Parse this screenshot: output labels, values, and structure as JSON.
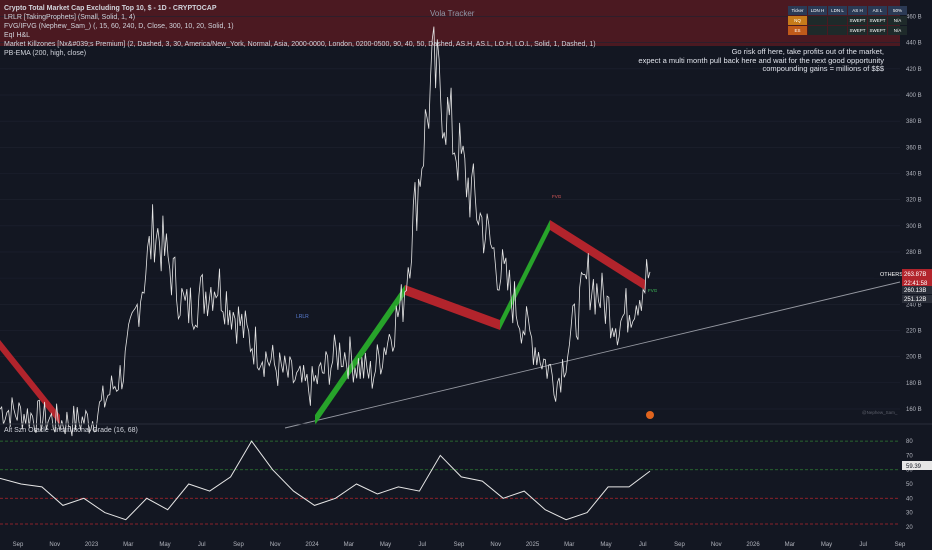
{
  "header": {
    "title": "Crypto Total Market Cap Excluding Top 10, $ - 1D - CRYPTOCAP",
    "indicators": [
      "LRLR [TakingProphets] (Small, Solid, 1, 4)",
      "FVG/IFVG (Nephew_Sam_) (, 15, 60, 240, D, Close, 300, 10, 20, Solid, 1)",
      "EqI H&L",
      "Market Killzones [Nx&#039;s Premium] (2, Dashed, 3, 30, America/New_York, Normal, Asia, 2000-0000, London, 0200-0500, 90, 40, 50, Dashed, AS.H, AS.L, LO.H, LO.L, Solid, 1, Dashed, 1)",
      "PB-EMA (200, high, close)"
    ],
    "zone_label": "Vola Tracker"
  },
  "annotation": {
    "lines": [
      "Go risk off here, take profits out of the market,",
      "expect a multi month pull back here and wait for the next good opportunity",
      "compounding gains = millions of $$$"
    ]
  },
  "table": {
    "headers": [
      "Ticker",
      "LDN H",
      "LDN L",
      "AS H",
      "AS L",
      "50%"
    ],
    "rows": [
      [
        "NQ",
        "",
        "",
        "SWEPT",
        "SWEPT",
        "N/A"
      ],
      [
        "ES",
        "",
        "",
        "SWEPT",
        "SWEPT",
        "N/A"
      ]
    ]
  },
  "badges": {
    "symbol": "OTHERS",
    "price": "263.87B",
    "countdown": "22:41:58",
    "level1": "260.13B",
    "level2": "251.12B",
    "watermark": "@Nephew_Sam_"
  },
  "markers": {
    "lrlr": "LRLR",
    "fvg": "FVG"
  },
  "colors": {
    "up_band": "#27a32a",
    "down_band": "#b2242c",
    "price": "#e6e6e6",
    "osc": "#e6e6e6",
    "bg": "#131722"
  },
  "chart_data": [
    {
      "type": "line",
      "title": "Crypto Total Market Cap Excluding Top 10, $ - 1D - CRYPTOCAP",
      "series": [
        {
          "name": "OTHERS",
          "x": [
            "2023-09",
            "2023-10",
            "2023-11",
            "2024-01",
            "2024-02",
            "2024-03",
            "2024-04",
            "2024-05",
            "2024-06",
            "2024-07",
            "2024-08",
            "2024-09",
            "2024-10",
            "2024-11",
            "2024-12",
            "2025-01",
            "2025-02",
            "2025-03",
            "2025-04",
            "2025-05",
            "2025-06",
            "2025-07"
          ],
          "values": [
            160,
            155,
            150,
            152,
            190,
            300,
            235,
            258,
            215,
            190,
            175,
            205,
            185,
            240,
            420,
            340,
            275,
            220,
            180,
            260,
            225,
            264
          ]
        }
      ],
      "ylim": [
        150,
        465
      ],
      "yticks": [
        160,
        180,
        200,
        220,
        240,
        260,
        280,
        300,
        320,
        340,
        360,
        380,
        400,
        420,
        440,
        460
      ],
      "ytick_labels": [
        "160 B",
        "180 B",
        "200 B",
        "220 B",
        "240 B",
        "260 B",
        "280 B",
        "300 B",
        "320 B",
        "340 B",
        "360 B",
        "380 B",
        "400 B",
        "420 B",
        "440 B",
        "460 B"
      ],
      "xtick_labels": [
        "Sep",
        "Nov",
        "2023",
        "Mar",
        "May",
        "Jul",
        "Sep",
        "Nov",
        "2024",
        "Mar",
        "May",
        "Jul",
        "Sep",
        "Nov",
        "2025",
        "Mar",
        "May",
        "Jul",
        "Sep",
        "Nov",
        "2026",
        "Mar",
        "May",
        "Jul",
        "Sep"
      ],
      "last_value": 263.87
    },
    {
      "type": "line",
      "title": "Alt Szn Oracle - Institutional Grade (16, 68)",
      "series": [
        {
          "values": [
            54,
            50,
            48,
            35,
            40,
            30,
            25,
            40,
            32,
            50,
            45,
            55,
            80,
            60,
            45,
            35,
            40,
            50,
            43,
            48,
            45,
            70,
            55,
            52,
            40,
            45,
            32,
            25,
            30,
            48,
            48,
            59
          ]
        }
      ],
      "ylim": [
        15,
        85
      ],
      "yticks": [
        20,
        30,
        40,
        50,
        60,
        70,
        80
      ],
      "ytick_labels": [
        "20",
        "30",
        "40",
        "50",
        "60",
        "70",
        "80"
      ],
      "levels": [
        80,
        60,
        40,
        22
      ],
      "last_value": "59.39"
    }
  ]
}
